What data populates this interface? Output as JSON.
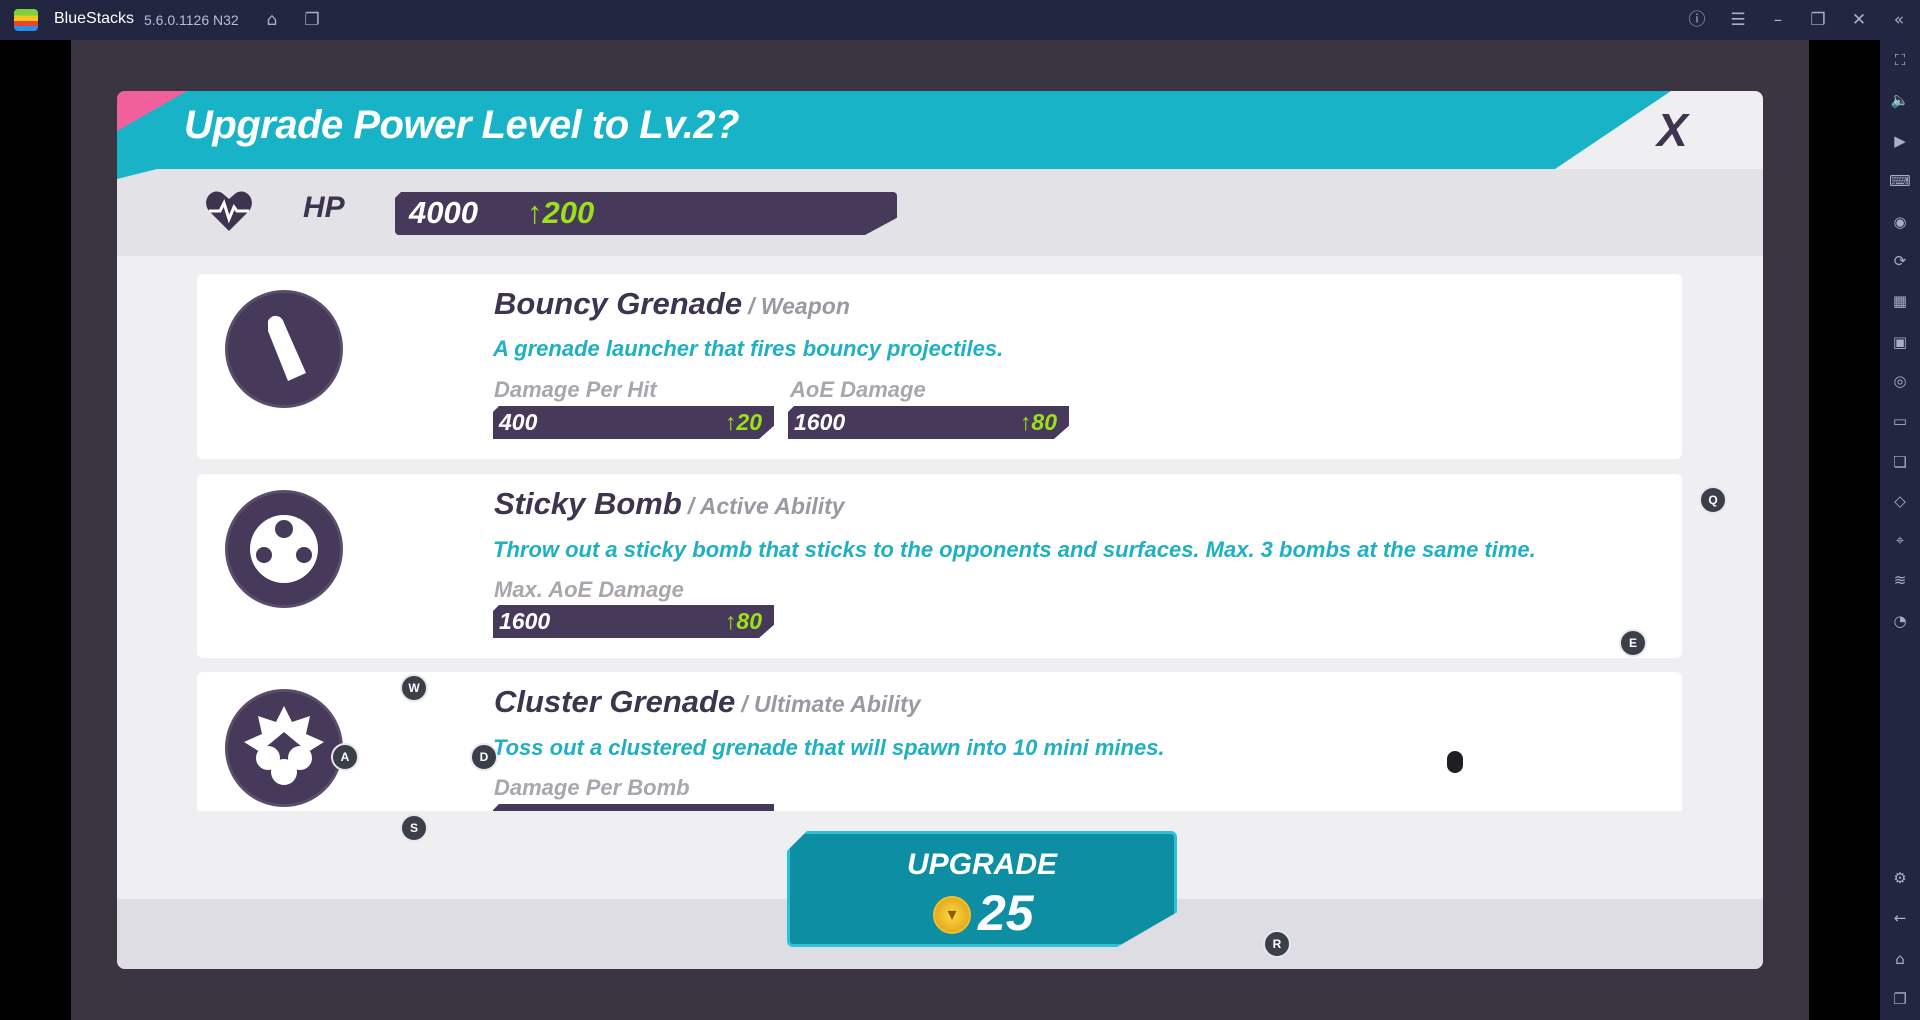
{
  "app": {
    "name": "BlueStacks",
    "version": "5.6.0.1126 N32"
  },
  "titlebar_icons": [
    "home-icon",
    "multi-instance-icon",
    "help-icon",
    "menu-icon",
    "minimize-icon",
    "restore-icon",
    "close-icon",
    "collapse-sidebar-icon"
  ],
  "sidebar_icons": [
    "fullscreen-icon",
    "volume-icon",
    "media-icon",
    "keyboard-icon",
    "record-icon",
    "rotate-icon",
    "gamepad-icon",
    "apk-icon",
    "screenshot-icon",
    "folder-icon",
    "multi-instance-icon",
    "eraser-icon",
    "location-icon",
    "layers-icon",
    "performance-icon",
    "settings-icon",
    "back-icon",
    "home-icon",
    "recent-apps-icon"
  ],
  "dialog": {
    "title": "Upgrade Power Level to Lv.2?",
    "close_label": "X",
    "hp": {
      "label": "HP",
      "value": "4000",
      "increase": "200"
    },
    "cards": [
      {
        "name": "Bouncy Grenade",
        "type": "/ Weapon",
        "description": "A grenade launcher that fires bouncy projectiles.",
        "icon": "bullet-icon",
        "stats": [
          {
            "label": "Damage Per Hit",
            "value": "400",
            "increase": "20"
          },
          {
            "label": "AoE Damage",
            "value": "1600",
            "increase": "80"
          }
        ]
      },
      {
        "name": "Sticky Bomb",
        "type": "/ Active Ability",
        "description": "Throw out a sticky bomb that sticks to the opponents and surfaces. Max. 3 bombs at the same time.",
        "icon": "sticky-bomb-icon",
        "stats": [
          {
            "label": "Max. AoE Damage",
            "value": "1600",
            "increase": "80"
          }
        ]
      },
      {
        "name": "Cluster Grenade",
        "type": "/ Ultimate Ability",
        "description": "Toss out a clustered grenade that will spawn into 10 mini mines.",
        "icon": "cluster-grenade-icon",
        "stats": [
          {
            "label": "Damage Per Bomb"
          }
        ]
      }
    ],
    "upgrade": {
      "label": "UPGRADE",
      "cost": "25",
      "currency_icon": "coin-icon"
    }
  },
  "key_hints": {
    "q": "Q",
    "e": "E",
    "w": "W",
    "a": "A",
    "d": "D",
    "s": "S",
    "r": "R"
  },
  "colors": {
    "accent": "#19b3c7",
    "bar": "#47395a",
    "increase": "#9be01a",
    "button": "#0d8ea3"
  }
}
